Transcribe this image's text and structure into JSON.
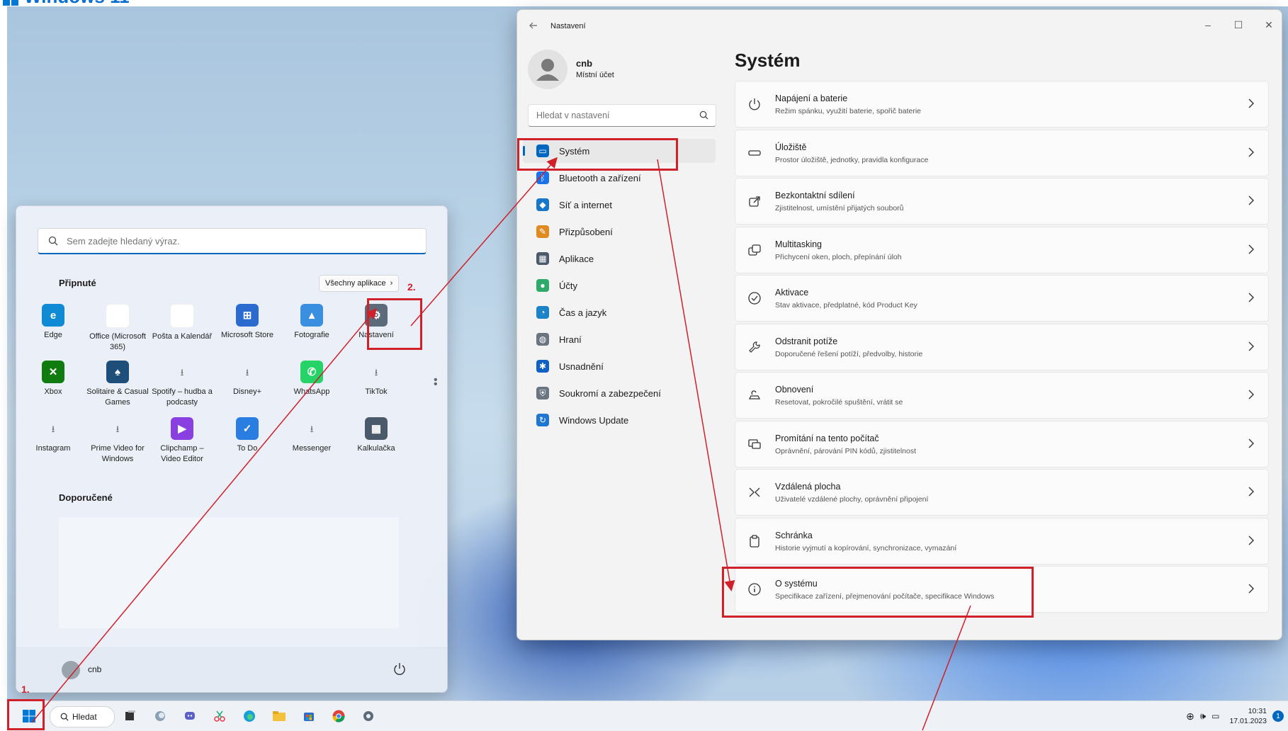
{
  "brand": {
    "title": "Windows 11"
  },
  "start_menu": {
    "search_placeholder": "Sem zadejte hledaný výraz.",
    "pinned_title": "Připnuté",
    "all_apps_label": "Všechny aplikace",
    "pinned": [
      {
        "label": "Edge",
        "icon": "edge-icon",
        "color": "#0f8bd6"
      },
      {
        "label": "Office (Microsoft 365)",
        "icon": "office-icon",
        "color": "#ffffff"
      },
      {
        "label": "Pošta a Kalendář",
        "icon": "mail-icon",
        "color": "#ffffff"
      },
      {
        "label": "Microsoft Store",
        "icon": "store-icon",
        "color": "#2b6bcf"
      },
      {
        "label": "Fotografie",
        "icon": "photos-icon",
        "color": "#3a8fe0"
      },
      {
        "label": "Nastavení",
        "icon": "gear-icon",
        "color": "#5b6b7a"
      },
      {
        "label": "Xbox",
        "icon": "xbox-icon",
        "color": "#107c10"
      },
      {
        "label": "Solitaire & Casual Games",
        "icon": "cards-icon",
        "color": "#1e4f7a"
      },
      {
        "label": "Spotify – hudba a podcasty",
        "icon": "download-icon",
        "color": ""
      },
      {
        "label": "Disney+",
        "icon": "download-icon",
        "color": ""
      },
      {
        "label": "WhatsApp",
        "icon": "whatsapp-icon",
        "color": "#25d366"
      },
      {
        "label": "TikTok",
        "icon": "download-icon",
        "color": ""
      },
      {
        "label": "Instagram",
        "icon": "download-icon",
        "color": ""
      },
      {
        "label": "Prime Video for Windows",
        "icon": "download-icon",
        "color": ""
      },
      {
        "label": "Clipchamp – Video Editor",
        "icon": "clipchamp-icon",
        "color": "#8a3fe0"
      },
      {
        "label": "To Do",
        "icon": "todo-icon",
        "color": "#2a7de1"
      },
      {
        "label": "Messenger",
        "icon": "download-icon",
        "color": ""
      },
      {
        "label": "Kalkulačka",
        "icon": "calculator-icon",
        "color": "#4a5a6a"
      }
    ],
    "recommended_title": "Doporučené",
    "user_name": "cnb"
  },
  "settings": {
    "window_title": "Nastavení",
    "account": {
      "name": "cnb",
      "type": "Místní účet"
    },
    "search_placeholder": "Hledat v nastavení",
    "nav": [
      {
        "label": "Systém",
        "icon": "system-icon",
        "color": "#0067c0",
        "active": true
      },
      {
        "label": "Bluetooth a zařízení",
        "icon": "bluetooth-icon",
        "color": "#1a73e8"
      },
      {
        "label": "Síť a internet",
        "icon": "wifi-icon",
        "color": "#1877c9"
      },
      {
        "label": "Přizpůsobení",
        "icon": "brush-icon",
        "color": "#e08a22"
      },
      {
        "label": "Aplikace",
        "icon": "apps-icon",
        "color": "#4b5a6a"
      },
      {
        "label": "Účty",
        "icon": "user-icon",
        "color": "#2eaa6a"
      },
      {
        "label": "Čas a jazyk",
        "icon": "globe-clock-icon",
        "color": "#1c83c8"
      },
      {
        "label": "Hraní",
        "icon": "gamepad-icon",
        "color": "#6b7580"
      },
      {
        "label": "Usnadnění",
        "icon": "accessibility-icon",
        "color": "#1160c4"
      },
      {
        "label": "Soukromí a zabezpečení",
        "icon": "shield-icon",
        "color": "#6a7582"
      },
      {
        "label": "Windows Update",
        "icon": "update-icon",
        "color": "#1f77d0"
      }
    ],
    "page_title": "Systém",
    "rows": [
      {
        "title": "Napájení a baterie",
        "desc": "Režim spánku, využití baterie, spořič baterie",
        "icon": "power-icon"
      },
      {
        "title": "Úložiště",
        "desc": "Prostor úložiště, jednotky, pravidla konfigurace",
        "icon": "storage-icon"
      },
      {
        "title": "Bezkontaktní sdílení",
        "desc": "Zjistitelnost, umístění přijatých souborů",
        "icon": "share-icon"
      },
      {
        "title": "Multitasking",
        "desc": "Přichycení oken, ploch, přepínání úloh",
        "icon": "multitask-icon"
      },
      {
        "title": "Aktivace",
        "desc": "Stav aktivace, předplatné, kód Product Key",
        "icon": "check-circle-icon"
      },
      {
        "title": "Odstranit potíže",
        "desc": "Doporučené řešení potíží, předvolby, historie",
        "icon": "wrench-icon"
      },
      {
        "title": "Obnovení",
        "desc": "Resetovat, pokročilé spuštění, vrátit se",
        "icon": "recovery-icon"
      },
      {
        "title": "Promítání na tento počítač",
        "desc": "Oprávnění, párování PIN kódů, zjistitelnost",
        "icon": "project-icon"
      },
      {
        "title": "Vzdálená plocha",
        "desc": "Uživatelé vzdálené plochy, oprávnění připojení",
        "icon": "remote-icon"
      },
      {
        "title": "Schránka",
        "desc": "Historie vyjmutí a kopírování, synchronizace, vymazání",
        "icon": "clipboard-icon"
      },
      {
        "title": "O systému",
        "desc": "Specifikace zařízení, přejmenování počítače, specifikace Windows",
        "icon": "info-icon"
      }
    ]
  },
  "taskbar": {
    "search_label": "Hledat",
    "time": "10:31",
    "date": "17.01.2023",
    "notification_count": "1"
  },
  "annotations": {
    "step1": "1.",
    "step2": "2.",
    "color": "#d0202a"
  }
}
